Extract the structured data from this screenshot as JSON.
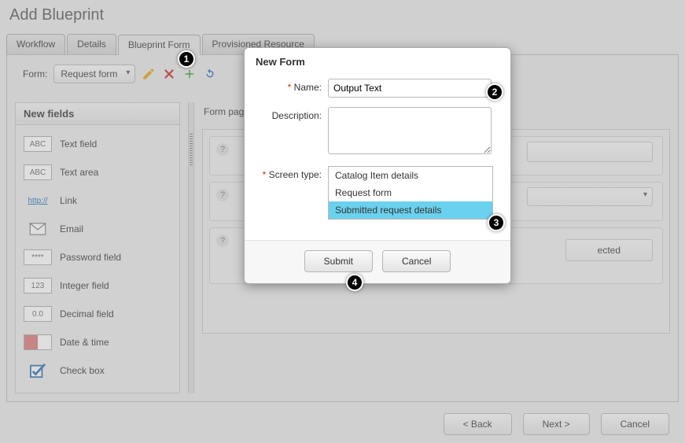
{
  "page_title": "Add Blueprint",
  "tabs": [
    "Workflow",
    "Details",
    "Blueprint Form",
    "Provisioned Resource"
  ],
  "active_tab": 2,
  "form_label": "Form:",
  "form_selected": "Request form",
  "form_page_label": "Form page:",
  "left_panel_title": "New fields",
  "fields": [
    {
      "glyph": "ABC",
      "label": "Text field"
    },
    {
      "glyph": "ABC",
      "label": "Text area"
    },
    {
      "glyph": "http://",
      "label": "Link"
    },
    {
      "glyph": "email",
      "label": "Email"
    },
    {
      "glyph": "****",
      "label": "Password field"
    },
    {
      "glyph": "123",
      "label": "Integer field"
    },
    {
      "glyph": "0.0",
      "label": "Decimal field"
    },
    {
      "glyph": "date",
      "label": "Date & time"
    },
    {
      "glyph": "check",
      "label": "Check box"
    }
  ],
  "row3_text": "ected",
  "footer": {
    "back": "< Back",
    "next": "Next >",
    "cancel": "Cancel"
  },
  "modal": {
    "title": "New Form",
    "name_label": "Name:",
    "name_value": "Output Text",
    "desc_label": "Description:",
    "desc_value": "",
    "screen_label": "Screen type:",
    "screen_options": [
      "Catalog Item details",
      "Request form",
      "Submitted request details"
    ],
    "screen_selected": 2,
    "submit": "Submit",
    "cancel": "Cancel"
  },
  "dots": [
    "1",
    "2",
    "3",
    "4"
  ]
}
